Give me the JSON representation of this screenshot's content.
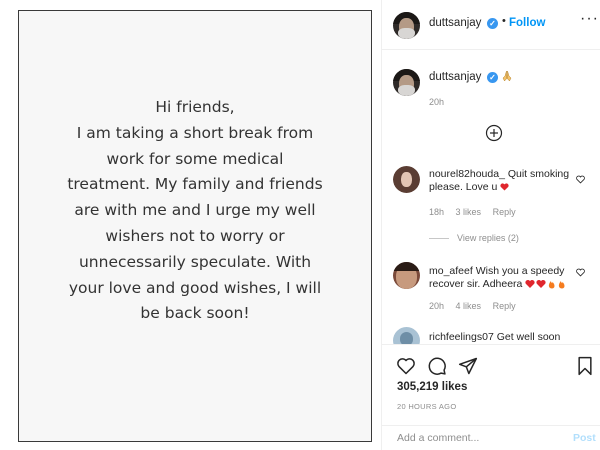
{
  "post": {
    "lines": [
      "Hi friends,",
      "I am taking a short break from",
      "work for some medical",
      "treatment. My family and friends",
      "are with me and I urge my well",
      "wishers not to worry or",
      "unnecessarily speculate. With",
      "your love and good wishes, I will",
      "be back soon!"
    ]
  },
  "header": {
    "username": "duttsanjay",
    "separator": "•",
    "follow_label": "Follow",
    "more_label": "···"
  },
  "caption": {
    "username": "duttsanjay",
    "time": "20h"
  },
  "comments": [
    {
      "username": "nourel82houda_",
      "text": "Quit smoking please. Love u",
      "time": "18h",
      "likes": "3 likes",
      "reply": "Reply"
    },
    {
      "username": "mo_afeef",
      "text": "Wish you a speedy recover sir. Adheera",
      "time": "20h",
      "likes": "4 likes",
      "reply": "Reply"
    },
    {
      "username": "richfeelings07",
      "text": "Get well soon"
    }
  ],
  "view_replies_label": "View replies (2)",
  "likes_label": "305,219 likes",
  "age_label": "20 HOURS AGO",
  "add_comment": {
    "placeholder": "Add a comment...",
    "post_label": "Post"
  },
  "colors": {
    "accent": "#0095f6",
    "verified": "#3897f0",
    "muted": "#8e8e8e",
    "heart": "#ed4956"
  }
}
